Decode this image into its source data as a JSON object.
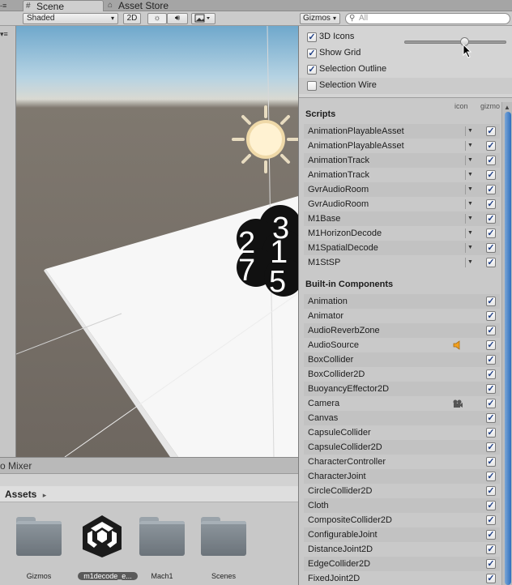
{
  "tabs": {
    "scene": "Scene",
    "asset_store": "Asset Store",
    "left_partial": "-≡"
  },
  "toolbar": {
    "shading_mode": "Shaded",
    "mode_2d": "2D",
    "lighting_icon": "sun-icon",
    "audio_icon": "speaker-icon",
    "effects_icon": "image-icon",
    "gizmos_label": "Gizmos",
    "search_placeholder": "All"
  },
  "left_sliver": {
    "label": "▾≡"
  },
  "scene": {
    "gizmo_numbers": [
      "3",
      "2",
      "1",
      "7",
      "5"
    ]
  },
  "bottom": {
    "mixer_label": "o Mixer",
    "assets_label": "Assets",
    "assets": [
      {
        "name": "Gizmos",
        "kind": "folder"
      },
      {
        "name": "m1decode_e...",
        "kind": "unity-scene"
      },
      {
        "name": "Mach1",
        "kind": "folder"
      },
      {
        "name": "Scenes",
        "kind": "folder"
      }
    ]
  },
  "gizmos_panel": {
    "options": [
      {
        "label": "3D Icons",
        "checked": true
      },
      {
        "label": "Show Grid",
        "checked": true
      },
      {
        "label": "Selection Outline",
        "checked": true
      },
      {
        "label": "Selection Wire",
        "checked": false
      }
    ],
    "icon_size_slider": 0.6,
    "columns": {
      "icon": "icon",
      "gizmo": "gizmo"
    },
    "scripts_title": "Scripts",
    "scripts": [
      {
        "name": "AnimationPlayableAsset",
        "checked": true
      },
      {
        "name": "AnimationPlayableAsset",
        "checked": true
      },
      {
        "name": "AnimationTrack",
        "checked": true
      },
      {
        "name": "AnimationTrack",
        "checked": true
      },
      {
        "name": "GvrAudioRoom",
        "checked": true
      },
      {
        "name": "GvrAudioRoom",
        "checked": true
      },
      {
        "name": "M1Base",
        "checked": true
      },
      {
        "name": "M1HorizonDecode",
        "checked": true
      },
      {
        "name": "M1SpatialDecode",
        "checked": true
      },
      {
        "name": "M1StSP",
        "checked": true
      }
    ],
    "builtin_title": "Built-in Components",
    "builtin": [
      {
        "name": "Animation",
        "checked": true,
        "icon": ""
      },
      {
        "name": "Animator",
        "checked": true,
        "icon": ""
      },
      {
        "name": "AudioReverbZone",
        "checked": true,
        "icon": ""
      },
      {
        "name": "AudioSource",
        "checked": true,
        "icon": "speaker-icon"
      },
      {
        "name": "BoxCollider",
        "checked": true,
        "icon": ""
      },
      {
        "name": "BoxCollider2D",
        "checked": true,
        "icon": ""
      },
      {
        "name": "BuoyancyEffector2D",
        "checked": true,
        "icon": ""
      },
      {
        "name": "Camera",
        "checked": true,
        "icon": "camera-icon"
      },
      {
        "name": "Canvas",
        "checked": true,
        "icon": ""
      },
      {
        "name": "CapsuleCollider",
        "checked": true,
        "icon": ""
      },
      {
        "name": "CapsuleCollider2D",
        "checked": true,
        "icon": ""
      },
      {
        "name": "CharacterController",
        "checked": true,
        "icon": ""
      },
      {
        "name": "CharacterJoint",
        "checked": true,
        "icon": ""
      },
      {
        "name": "CircleCollider2D",
        "checked": true,
        "icon": ""
      },
      {
        "name": "Cloth",
        "checked": true,
        "icon": ""
      },
      {
        "name": "CompositeCollider2D",
        "checked": true,
        "icon": ""
      },
      {
        "name": "ConfigurableJoint",
        "checked": true,
        "icon": ""
      },
      {
        "name": "DistanceJoint2D",
        "checked": true,
        "icon": ""
      },
      {
        "name": "EdgeCollider2D",
        "checked": true,
        "icon": ""
      },
      {
        "name": "FixedJoint2D",
        "checked": true,
        "icon": ""
      }
    ],
    "colors": {
      "check": "#1f3f86",
      "speaker": "#f0a020",
      "scroll_thumb": "#2f6fbf"
    }
  }
}
